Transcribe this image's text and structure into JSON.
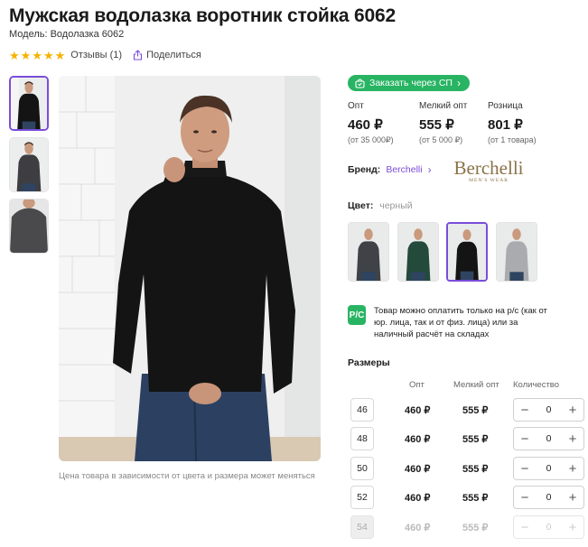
{
  "product": {
    "title": "Мужская водолазка воротник стойка 6062",
    "model": "Модель: Водолазка 6062",
    "rating": 5,
    "reviews": "Отзывы (1)",
    "share": "Поделиться"
  },
  "gallery": {
    "thumbnails": [
      "black",
      "gray",
      "dark-gray"
    ],
    "caption": "Цена товара в зависимости от цвета и размера может меняться"
  },
  "order_button": "Заказать через СП",
  "prices": [
    {
      "label": "Опт",
      "value": "460 ₽",
      "note": "(от 35 000₽)"
    },
    {
      "label": "Мелкий опт",
      "value": "555 ₽",
      "note": "(от 5 000 ₽)"
    },
    {
      "label": "Розница",
      "value": "801 ₽",
      "note": "(от 1 товара)"
    }
  ],
  "brand": {
    "label": "Бренд:",
    "name": "Berchelli",
    "logo_text": "Berchelli",
    "logo_subtext": "MEN'S WEAR"
  },
  "color": {
    "label": "Цвет:",
    "value": "черный",
    "swatches": [
      "dark-gray",
      "green",
      "black",
      "light-gray"
    ]
  },
  "payment": {
    "icon_text": "Р/С",
    "note": "Товар можно оплатить только на р/с (как от юр. лица, так и от физ. лица) или за наличный расчёт на складах"
  },
  "sizes": {
    "title": "Размеры",
    "headers": {
      "opt": "Опт",
      "small": "Мелкий опт",
      "qty": "Количество"
    },
    "rows": [
      {
        "size": "46",
        "opt": "460 ₽",
        "small": "555 ₽",
        "qty": "0"
      },
      {
        "size": "48",
        "opt": "460 ₽",
        "small": "555 ₽",
        "qty": "0"
      },
      {
        "size": "50",
        "opt": "460 ₽",
        "small": "555 ₽",
        "qty": "0"
      },
      {
        "size": "52",
        "opt": "460 ₽",
        "small": "555 ₽",
        "qty": "0"
      },
      {
        "size": "54",
        "opt": "460 ₽",
        "small": "555 ₽",
        "qty": "0",
        "disabled": true
      }
    ],
    "minus": "−",
    "plus": "+"
  },
  "colors": {
    "accent": "#7a4dd8",
    "green": "#28b463",
    "star": "#f5b301"
  }
}
